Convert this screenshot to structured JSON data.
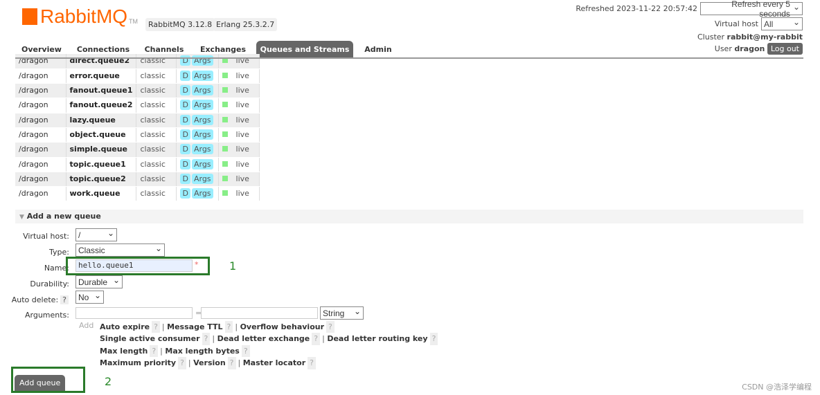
{
  "header": {
    "logo_text": "RabbitMQ",
    "logo_tm": "TM",
    "version": "RabbitMQ 3.12.8",
    "erlang": "Erlang 25.3.2.7",
    "refreshed": "Refreshed 2023-11-22 20:57:42",
    "refresh_select": "Refresh every 5 seconds",
    "vhost_label": "Virtual host",
    "vhost_value": "All",
    "cluster_label": "Cluster",
    "cluster": "rabbit@my-rabbit",
    "user_label": "User",
    "user": "dragon",
    "logout": "Log out"
  },
  "tabs": [
    "Overview",
    "Connections",
    "Channels",
    "Exchanges",
    "Queues and Streams",
    "Admin"
  ],
  "active_tab": "Queues and Streams",
  "queues": [
    {
      "vhost": "/dragon",
      "name": "direct.queue2",
      "type": "classic",
      "d": "D",
      "args": "Args",
      "state": "live"
    },
    {
      "vhost": "/dragon",
      "name": "error.queue",
      "type": "classic",
      "d": "D",
      "args": "Args",
      "state": "live"
    },
    {
      "vhost": "/dragon",
      "name": "fanout.queue1",
      "type": "classic",
      "d": "D",
      "args": "Args",
      "state": "live"
    },
    {
      "vhost": "/dragon",
      "name": "fanout.queue2",
      "type": "classic",
      "d": "D",
      "args": "Args",
      "state": "live"
    },
    {
      "vhost": "/dragon",
      "name": "lazy.queue",
      "type": "classic",
      "d": "D",
      "args": "Args",
      "state": "live"
    },
    {
      "vhost": "/dragon",
      "name": "object.queue",
      "type": "classic",
      "d": "D",
      "args": "Args",
      "state": "live"
    },
    {
      "vhost": "/dragon",
      "name": "simple.queue",
      "type": "classic",
      "d": "D",
      "args": "Args",
      "state": "live"
    },
    {
      "vhost": "/dragon",
      "name": "topic.queue1",
      "type": "classic",
      "d": "D",
      "args": "Args",
      "state": "live"
    },
    {
      "vhost": "/dragon",
      "name": "topic.queue2",
      "type": "classic",
      "d": "D",
      "args": "Args",
      "state": "live"
    },
    {
      "vhost": "/dragon",
      "name": "work.queue",
      "type": "classic",
      "d": "D",
      "args": "Args",
      "state": "live"
    }
  ],
  "form": {
    "section": "Add a new queue",
    "vhost_label": "Virtual host:",
    "vhost": "/",
    "type_label": "Type:",
    "type": "Classic",
    "name_label": "Name:",
    "name": "hello.queue1",
    "required": "*",
    "durability_label": "Durability:",
    "durability": "Durable",
    "autodelete_label": "Auto delete:",
    "autodelete": "No",
    "help": "?",
    "arguments_label": "Arguments:",
    "eq": "=",
    "arg_type": "String",
    "add": "Add",
    "submit": "Add queue",
    "arg_links": [
      [
        "Auto expire",
        "Message TTL",
        "Overflow behaviour"
      ],
      [
        "Single active consumer",
        "Dead letter exchange",
        "Dead letter routing key"
      ],
      [
        "Max length",
        "Max length bytes"
      ],
      [
        "Maximum priority",
        "Version",
        "Master locator"
      ]
    ]
  },
  "annotations": {
    "one": "1",
    "two": "2",
    "highlight_color": "#2a7a2a"
  },
  "watermark": "CSDN @浩泽学编程"
}
